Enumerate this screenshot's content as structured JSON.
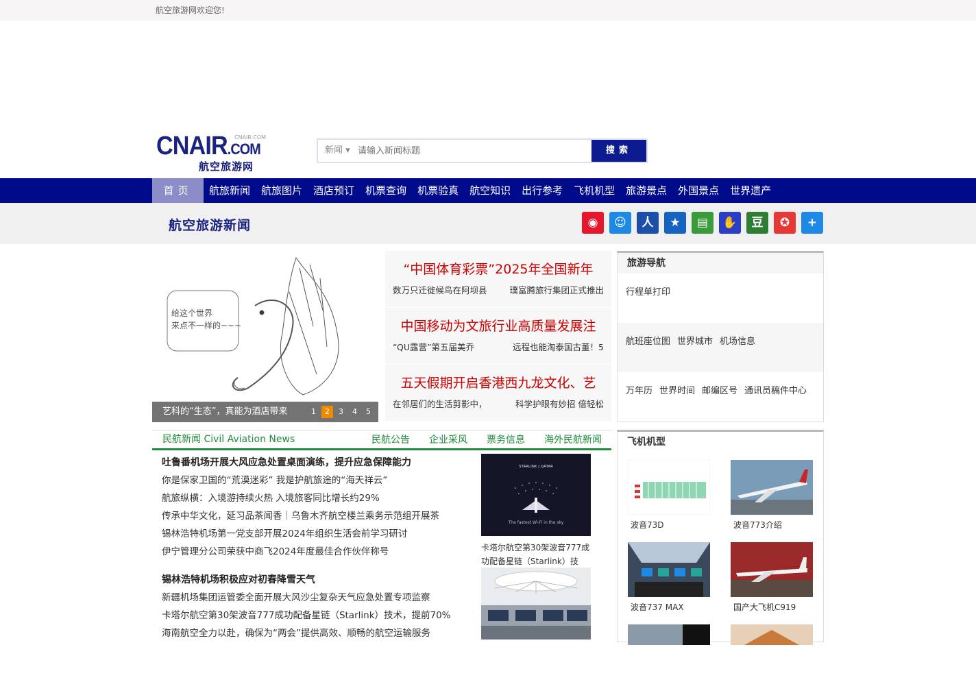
{
  "topbar": {
    "welcome": "航空旅游网欢迎您!"
  },
  "logo": {
    "main": "CNAIR",
    "suffix": ".COM",
    "small": "CNAIR.COM",
    "cn": "航空旅游网"
  },
  "search": {
    "category": "新闻 ▾",
    "placeholder": "请输入新闻标题",
    "button": "搜索"
  },
  "nav": [
    "首页",
    "航旅新闻",
    "航旅图片",
    "酒店预订",
    "机票查询",
    "机票验真",
    "航空知识",
    "出行参考",
    "飞机机型",
    "旅游景点",
    "外国景点",
    "世界遗产"
  ],
  "band": {
    "title": "航空旅游新闻"
  },
  "share": [
    {
      "name": "weibo-icon",
      "glyph": "◉",
      "color": "#e6162d"
    },
    {
      "name": "qzone-icon",
      "glyph": "☺",
      "color": "#1e88e5"
    },
    {
      "name": "renren-icon",
      "glyph": "人",
      "color": "#1e4fa8"
    },
    {
      "name": "favorite-icon",
      "glyph": "★",
      "color": "#1565c0"
    },
    {
      "name": "kaixin-icon",
      "glyph": "▤",
      "color": "#3a9b3a"
    },
    {
      "name": "baidu-icon",
      "glyph": "✋",
      "color": "#2a3ec8"
    },
    {
      "name": "douban-icon",
      "glyph": "豆",
      "color": "#2e7d32"
    },
    {
      "name": "star-icon",
      "glyph": "✪",
      "color": "#e53935"
    },
    {
      "name": "more-icon",
      "glyph": "+",
      "color": "#1e88e5"
    }
  ],
  "slider": {
    "caption": "艺科的“生态”，真能为酒店带来",
    "pages": [
      "1",
      "2",
      "3",
      "4",
      "5"
    ],
    "active": "2",
    "bubble": "给这个世界\n来点不一样的~~~"
  },
  "headlines": [
    {
      "title": "“中国体育彩票”2025年全国新年",
      "subs": [
        "数万只迁徙候鸟在阿坝县",
        "璞富腾旅行集团正式推出"
      ]
    },
    {
      "title": "中国移动为文旅行业高质量发展注",
      "subs": [
        "“QU露营”第五届美乔",
        "远程也能淘泰国古董！5"
      ]
    },
    {
      "title": "五天假期开启香港西九龙文化、艺",
      "subs": [
        "在邻居们的生活剪影中，",
        "科学护眼有妙招 倍轻松"
      ]
    }
  ],
  "guide": {
    "title": "旅游导航",
    "rows": [
      [
        "行程单打印"
      ],
      [
        "航班座位图",
        "世界城市",
        "机场信息"
      ],
      [
        "万年历",
        "世界时间",
        "邮编区号",
        "通讯员稿件中心"
      ]
    ]
  },
  "civil": {
    "title": "民航新闻 Civil Aviation News",
    "links": [
      "民航公告",
      "企业采风",
      "票务信息",
      "海外民航新闻"
    ]
  },
  "news1": {
    "lead": "吐鲁番机场开展大风应急处置桌面演练，提升应急保障能力",
    "items": [
      "你是保家卫国的“荒漠迷彩” 我是护航旅途的“海天祥云”",
      "航旅纵横：入境游持续火热 入境旅客同比增长约29%",
      "传承中华文化，延习品茶闻香｜乌鲁木齐航空楼兰乘务示范组开展茶",
      "锡林浩特机场第一党支部开展2024年组织生活会前学习研讨",
      "伊宁管理分公司荣获中商飞2024年度最佳合作伙伴称号"
    ]
  },
  "news2": {
    "lead": "锡林浩特机场积极应对初春降雪天气",
    "items": [
      "新疆机场集团运管委全面开展大风沙尘复杂天气应急处置专项监察",
      "卡塔尔航空第30架波音777成功配备星链（Starlink）技术，提前70%",
      "海南航空全力以赴，确保为“两会”提供高效、顺畅的航空运输服务"
    ]
  },
  "thumb1": {
    "caption": "卡塔尔航空第30架波音777成功配备星链（Starlink）技",
    "img_text1": "STARLINK | QATAR",
    "img_text2": "The fastest Wi-Fi in the sky"
  },
  "planes": {
    "title": "飞机机型",
    "items": [
      "波音73D",
      "波音773介绍",
      "波音737 MAX",
      "国产大飞机C919"
    ]
  }
}
